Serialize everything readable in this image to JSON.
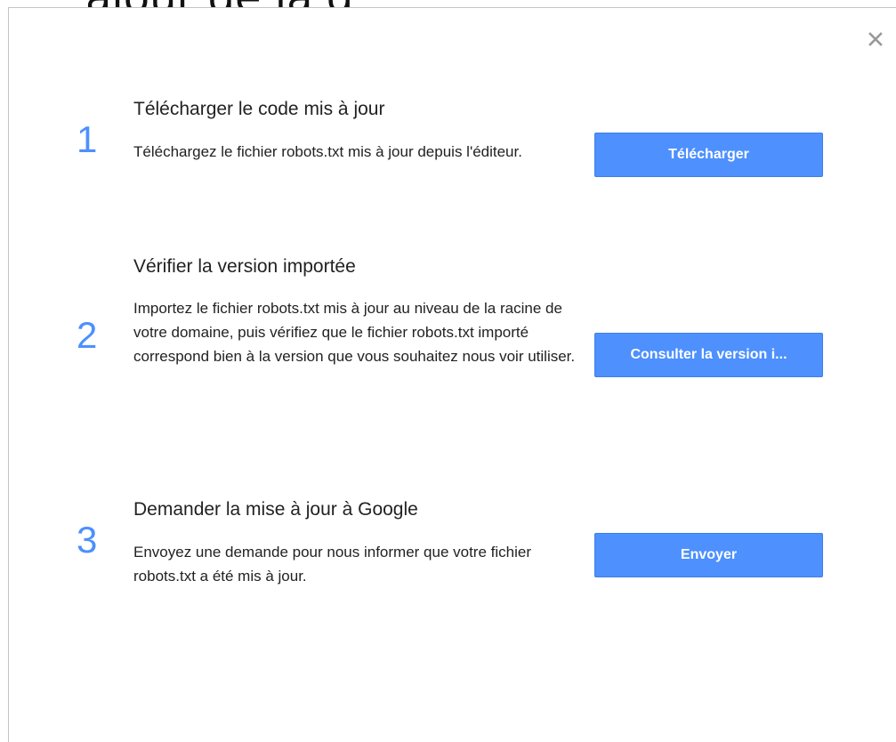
{
  "background_title": "ajour de la g",
  "dialog": {
    "close_glyph": "×",
    "steps": [
      {
        "number": "1",
        "title": "Télécharger le code mis à jour",
        "description": "Téléchargez le fichier robots.txt mis à jour depuis l'éditeur.",
        "button_label": "Télécharger"
      },
      {
        "number": "2",
        "title": "Vérifier la version importée",
        "description": "Importez le fichier robots.txt mis à jour au niveau de la racine de votre domaine, puis vérifiez que le fichier robots.txt importé correspond bien à la version que vous souhaitez nous voir utiliser.",
        "button_label": "Consulter la version i..."
      },
      {
        "number": "3",
        "title": "Demander la mise à jour à Google",
        "description": "Envoyez une demande pour nous informer que votre fichier robots.txt a été mis à jour.",
        "button_label": "Envoyer"
      }
    ]
  },
  "colors": {
    "accent": "#4d90fe",
    "text": "#222222",
    "close_icon": "#999999"
  },
  "icons": {
    "close": "close-icon"
  }
}
